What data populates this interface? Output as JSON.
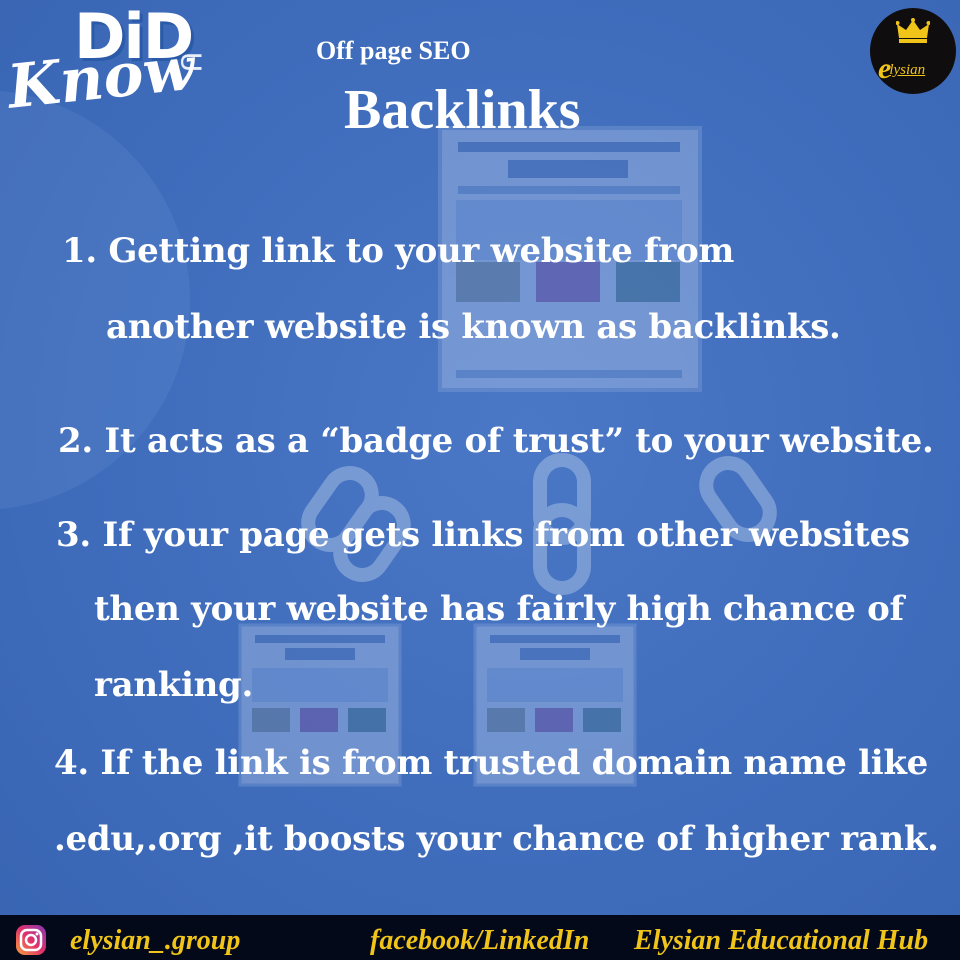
{
  "logo": {
    "did": "DiD",
    "u": "U",
    "know": "Know"
  },
  "header": {
    "kicker": "Off page SEO",
    "title": "Backlinks"
  },
  "brand": {
    "initial": "e",
    "rest": "lysian",
    "crown_icon": "crown-icon",
    "accent": "#f0c419"
  },
  "points": [
    {
      "lines": [
        "1. Getting link to your website from",
        "another website is known as backlinks."
      ]
    },
    {
      "lines": [
        "2. It acts as a “badge of trust” to your website."
      ]
    },
    {
      "lines": [
        "3. If your page gets links from other websites",
        "then your website has fairly high chance of",
        "ranking."
      ]
    },
    {
      "lines": [
        "4. If the link is from trusted domain name like",
        ".edu,.org ,it boosts your chance of higher rank."
      ]
    }
  ],
  "footer": {
    "instagram_icon": "instagram-icon",
    "instagram_handle": "elysian_.group",
    "social": "facebook/LinkedIn",
    "org": "Elysian Educational Hub"
  },
  "colors": {
    "background": "#3f6dbc",
    "footer_bg": "#04091a",
    "footer_text": "#f0c419"
  }
}
